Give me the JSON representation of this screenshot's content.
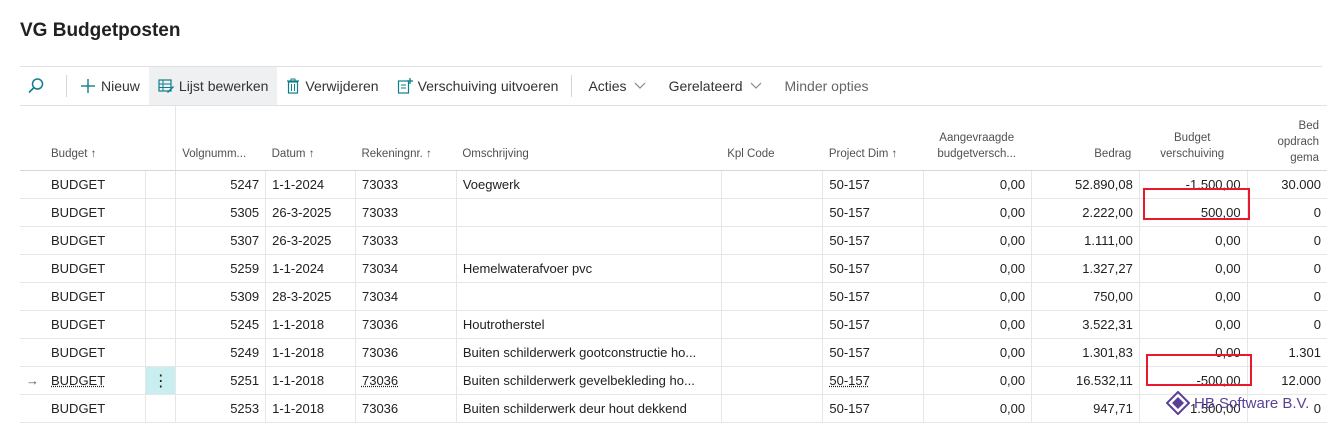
{
  "page": {
    "title": "VG Budgetposten"
  },
  "toolbar": {
    "new_label": "Nieuw",
    "edit_list_label": "Lijst bewerken",
    "delete_label": "Verwijderen",
    "shift_label": "Verschuiving uitvoeren",
    "actions_label": "Acties",
    "related_label": "Gerelateerd",
    "fewer_label": "Minder opties"
  },
  "columns": {
    "budget": "Budget ↑",
    "volgnummer": "Volgnumm...",
    "datum": "Datum ↑",
    "rekening": "Rekeningnr. ↑",
    "omschrijving": "Omschrijving",
    "kpl": "Kpl Code",
    "project": "Project Dim ↑",
    "aangevraagd1": "Aangevraagde",
    "aangevraagd2": "budgetversch...",
    "bedrag": "Bedrag",
    "budget_shift1": "Budget",
    "budget_shift2": "verschuiving",
    "bed1": "Bed",
    "bed2": "opdrach",
    "bed3": "gema"
  },
  "rows": [
    {
      "budget": "BUDGET",
      "vnr": "5247",
      "datum": "1-1-2024",
      "rek": "73033",
      "oms": "Voegwerk",
      "kpl": "",
      "proj": "50-157",
      "aang": "0,00",
      "bedrag": "52.890,08",
      "shift": "-1.500,00",
      "bed": "30.000"
    },
    {
      "budget": "BUDGET",
      "vnr": "5305",
      "datum": "26-3-2025",
      "rek": "73033",
      "oms": "",
      "kpl": "",
      "proj": "50-157",
      "aang": "0,00",
      "bedrag": "2.222,00",
      "shift": "500,00",
      "bed": "0"
    },
    {
      "budget": "BUDGET",
      "vnr": "5307",
      "datum": "26-3-2025",
      "rek": "73033",
      "oms": "",
      "kpl": "",
      "proj": "50-157",
      "aang": "0,00",
      "bedrag": "1.111,00",
      "shift": "0,00",
      "bed": "0"
    },
    {
      "budget": "BUDGET",
      "vnr": "5259",
      "datum": "1-1-2024",
      "rek": "73034",
      "oms": "Hemelwaterafvoer pvc",
      "kpl": "",
      "proj": "50-157",
      "aang": "0,00",
      "bedrag": "1.327,27",
      "shift": "0,00",
      "bed": "0"
    },
    {
      "budget": "BUDGET",
      "vnr": "5309",
      "datum": "28-3-2025",
      "rek": "73034",
      "oms": "",
      "kpl": "",
      "proj": "50-157",
      "aang": "0,00",
      "bedrag": "750,00",
      "shift": "0,00",
      "bed": "0"
    },
    {
      "budget": "BUDGET",
      "vnr": "5245",
      "datum": "1-1-2018",
      "rek": "73036",
      "oms": "Houtrotherstel",
      "kpl": "",
      "proj": "50-157",
      "aang": "0,00",
      "bedrag": "3.522,31",
      "shift": "0,00",
      "bed": "0"
    },
    {
      "budget": "BUDGET",
      "vnr": "5249",
      "datum": "1-1-2018",
      "rek": "73036",
      "oms": "Buiten schilderwerk gootconstructie ho...",
      "kpl": "",
      "proj": "50-157",
      "aang": "0,00",
      "bedrag": "1.301,83",
      "shift": "0,00",
      "bed": "1.301"
    },
    {
      "budget": "BUDGET",
      "vnr": "5251",
      "datum": "1-1-2018",
      "rek": "73036",
      "oms": "Buiten schilderwerk gevelbekleding ho...",
      "kpl": "",
      "proj": "50-157",
      "aang": "0,00",
      "bedrag": "16.532,11",
      "shift": "-500,00",
      "bed": "12.000"
    },
    {
      "budget": "BUDGET",
      "vnr": "5253",
      "datum": "1-1-2018",
      "rek": "73036",
      "oms": "Buiten schilderwerk deur hout dekkend",
      "kpl": "",
      "proj": "50-157",
      "aang": "0,00",
      "bedrag": "947,71",
      "shift": "1.500,00",
      "bed": "0"
    }
  ],
  "watermark": {
    "text": "HB Software B.V."
  }
}
